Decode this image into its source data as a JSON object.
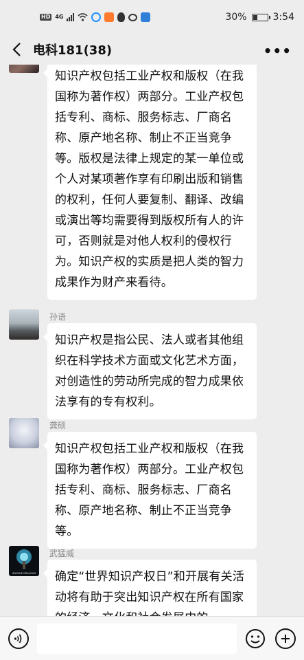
{
  "status_bar": {
    "hd": "HD",
    "network": "4G",
    "battery_percent": "30%",
    "time": "3:54"
  },
  "title_bar": {
    "title": "电科181(38)",
    "more_glyph": "•••"
  },
  "messages": [
    {
      "sender": "",
      "text": "知识产权包括工业产权和版权（在我国称为著作权）两部分。工业产权包括专利、商标、服务标志、厂商名称、原产地名称、制止不正当竞争等。版权是法律上规定的某一单位或个人对某项著作享有印刷出版和销售的权利，任何人要复制、翻译、改编或演出等均需要得到版权所有人的许可，否则就是对他人权利的侵权行为。知识产权的实质是把人类的智力成果作为财产来看待。"
    },
    {
      "sender": "孙语",
      "text": "知识产权是指公民、法人或者其他组织在科学技术方面或文化艺术方面，对创造性的劳动所完成的智力成果依法享有的专有权利。"
    },
    {
      "sender": "龚硕",
      "text": "知识产权包括工业产权和版权（在我国称为著作权）两部分。工业产权包括专利、商标、服务标志、厂商名称、原产地名称、制止不正当竞争等。"
    },
    {
      "sender": "武猛威",
      "avatar_caption": "IMAGINE DRAGONS",
      "text": "确定“世界知识产权日”和开展有关活动将有助于突出知识产权在所有国家的经济、文化和社会发展中的"
    }
  ],
  "input_bar": {
    "placeholder": ""
  },
  "colors": {
    "background": "#ededed",
    "bubble": "#ffffff",
    "sender_name": "#8a8a8a"
  },
  "icons": [
    "back-icon",
    "more-icon",
    "voice-icon",
    "emoji-icon",
    "plus-icon"
  ]
}
